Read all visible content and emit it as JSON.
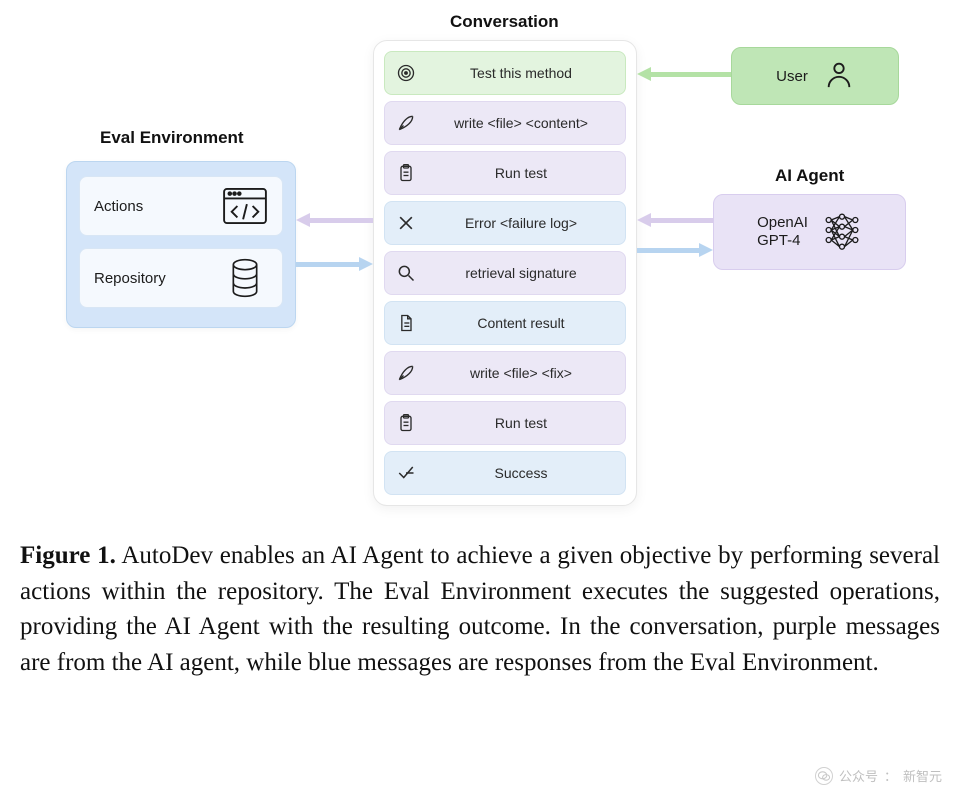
{
  "titles": {
    "eval": "Eval Environment",
    "conversation": "Conversation",
    "agent": "AI Agent"
  },
  "eval": {
    "actions": "Actions",
    "repository": "Repository"
  },
  "user": {
    "label": "User"
  },
  "agent": {
    "label": "OpenAI\nGPT-4"
  },
  "conversation": [
    {
      "icon": "target-icon",
      "style": "green",
      "text": "Test this method"
    },
    {
      "icon": "quill-icon",
      "style": "purple",
      "text": "write <file> <content>"
    },
    {
      "icon": "clipboard-icon",
      "style": "purple",
      "text": "Run test"
    },
    {
      "icon": "x-icon",
      "style": "blue",
      "text": "Error <failure log>"
    },
    {
      "icon": "search-icon",
      "style": "purple",
      "text": "retrieval signature"
    },
    {
      "icon": "document-icon",
      "style": "blue",
      "text": "Content result"
    },
    {
      "icon": "quill-icon",
      "style": "purple",
      "text": "write <file> <fix>"
    },
    {
      "icon": "clipboard-icon",
      "style": "purple",
      "text": "Run test"
    },
    {
      "icon": "check-icon",
      "style": "blue",
      "text": "Success"
    }
  ],
  "caption": {
    "label": "Figure 1.",
    "text": " AutoDev enables an AI Agent to achieve a given objective by performing several actions within the repository. The Eval Environment executes the suggested operations, providing the AI Agent with the resulting outcome. In the conversation, purple messages are from the AI agent, while blue messages are responses from the Eval Environment."
  },
  "watermark": {
    "source": "公众号",
    "sep": "：",
    "name": "新智元"
  },
  "colors": {
    "green": "#bfe6b6",
    "purple": "#e9e3f6",
    "blue": "#d4e5f9"
  }
}
